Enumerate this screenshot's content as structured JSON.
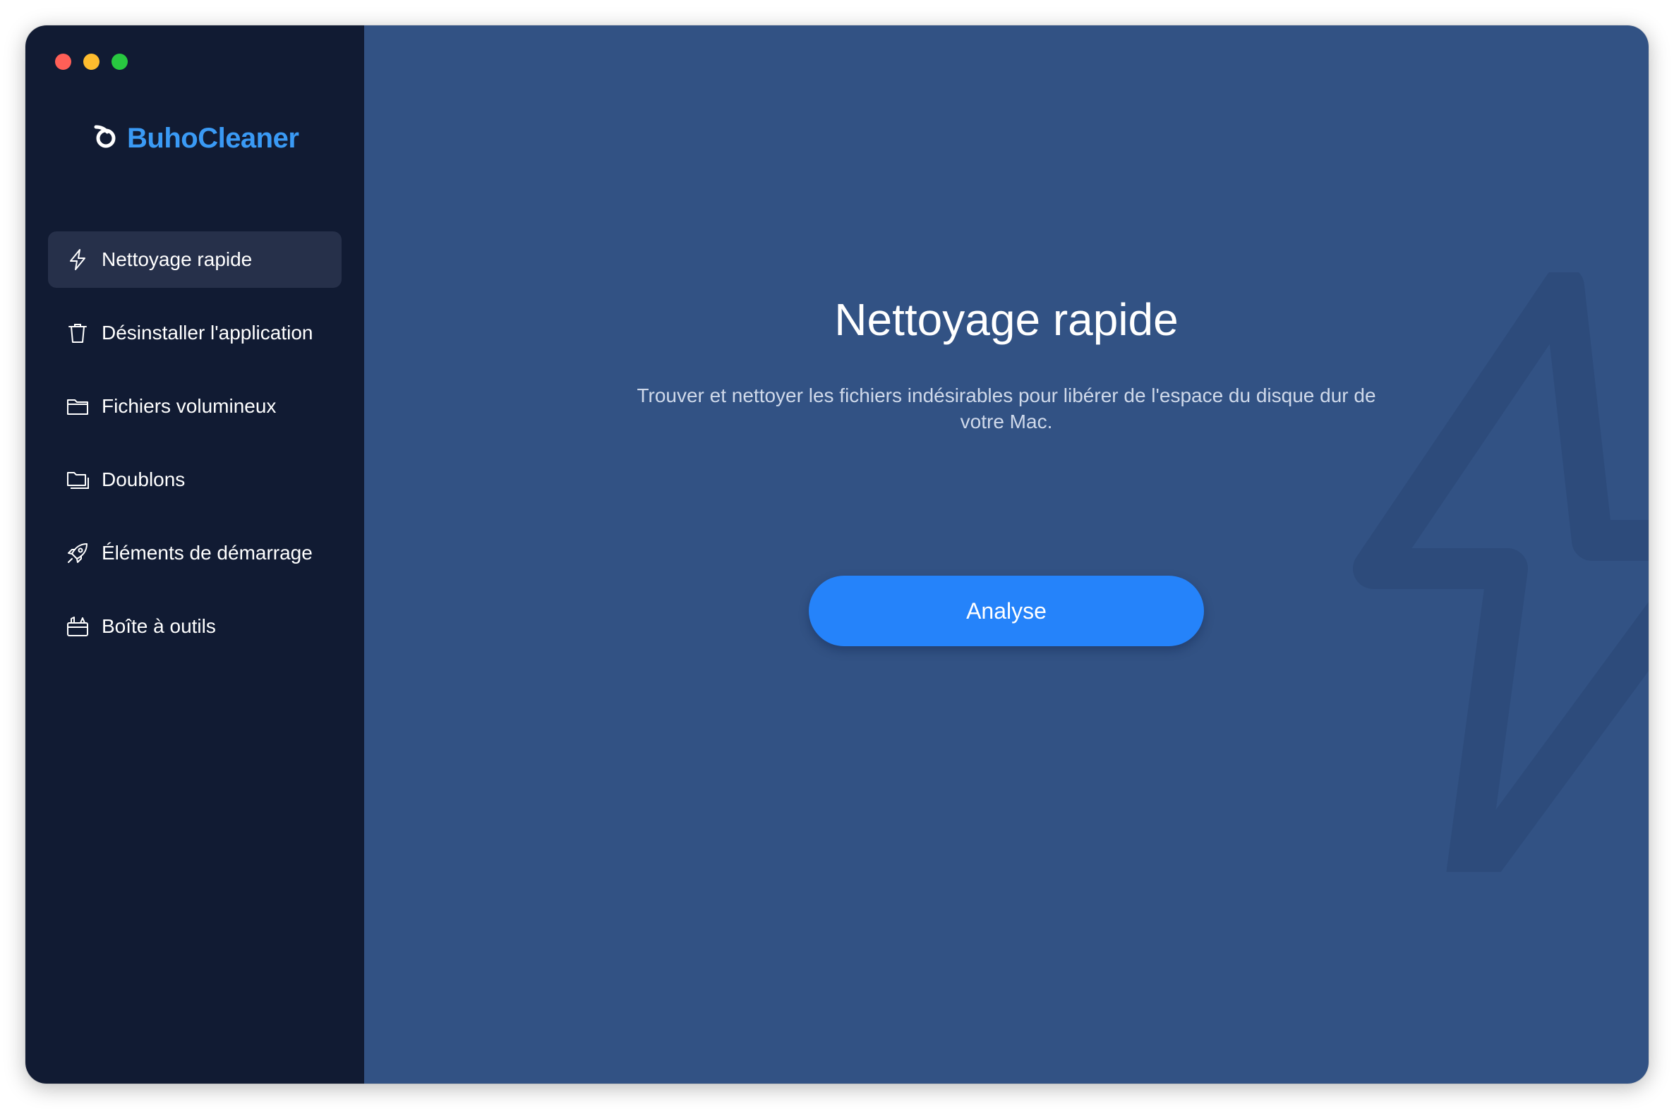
{
  "window": {
    "traffic_lights": [
      {
        "name": "close",
        "color": "#ff5f57"
      },
      {
        "name": "minimize",
        "color": "#febc2e"
      },
      {
        "name": "zoom",
        "color": "#28c840"
      }
    ]
  },
  "sidebar": {
    "logo_text": "BuhoCleaner",
    "logo_icon": "buho-logo-icon",
    "items": [
      {
        "label": "Nettoyage rapide",
        "icon": "lightning-icon",
        "active": true
      },
      {
        "label": "Désinstaller l'application",
        "icon": "trash-icon",
        "active": false
      },
      {
        "label": "Fichiers volumineux",
        "icon": "folder-icon",
        "active": false
      },
      {
        "label": "Doublons",
        "icon": "duplicate-folder-icon",
        "active": false
      },
      {
        "label": "Éléments de démarrage",
        "icon": "rocket-icon",
        "active": false
      },
      {
        "label": "Boîte à outils",
        "icon": "toolbox-icon",
        "active": false
      }
    ]
  },
  "main": {
    "title": "Nettoyage rapide",
    "subtitle": "Trouver et nettoyer les fichiers indésirables pour libérer de l'espace du disque dur de votre Mac.",
    "button_label": "Analyse",
    "background_icon": "lightning-icon"
  },
  "colors": {
    "sidebar_bg": "#111b33",
    "sidebar_active_bg": "#26304a",
    "main_bg": "#325284",
    "accent": "#2583fa",
    "logo": "#3a9af5"
  }
}
